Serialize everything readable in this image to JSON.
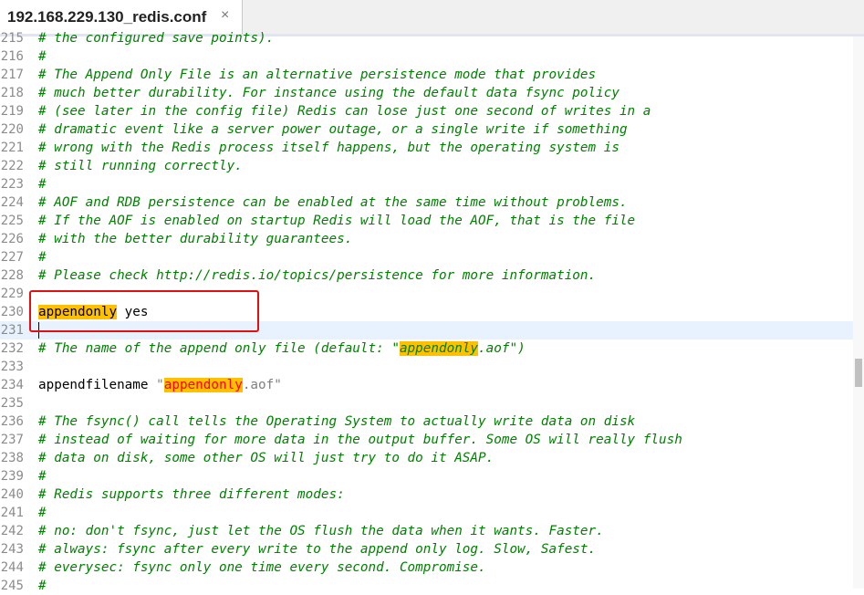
{
  "tab": {
    "title": "192.168.229.130_redis.conf",
    "close_icon": "×"
  },
  "lines": [
    {
      "n": "215",
      "segs": [
        {
          "t": "# the configured save points).",
          "c": "comment"
        }
      ]
    },
    {
      "n": "216",
      "segs": [
        {
          "t": "#",
          "c": "comment"
        }
      ]
    },
    {
      "n": "217",
      "segs": [
        {
          "t": "# The Append Only File is an alternative persistence mode that provides",
          "c": "comment"
        }
      ]
    },
    {
      "n": "218",
      "segs": [
        {
          "t": "# much better durability. For instance using the default data fsync policy",
          "c": "comment"
        }
      ]
    },
    {
      "n": "219",
      "segs": [
        {
          "t": "# (see later in the config file) Redis can lose just one second of writes in a",
          "c": "comment"
        }
      ]
    },
    {
      "n": "220",
      "segs": [
        {
          "t": "# dramatic event like a server power outage, or a single write if something",
          "c": "comment"
        }
      ]
    },
    {
      "n": "221",
      "segs": [
        {
          "t": "# wrong with the Redis process itself happens, but the operating system is",
          "c": "comment"
        }
      ]
    },
    {
      "n": "222",
      "segs": [
        {
          "t": "# still running correctly.",
          "c": "comment"
        }
      ]
    },
    {
      "n": "223",
      "segs": [
        {
          "t": "#",
          "c": "comment"
        }
      ]
    },
    {
      "n": "224",
      "segs": [
        {
          "t": "# AOF and RDB persistence can be enabled at the same time without problems.",
          "c": "comment"
        }
      ]
    },
    {
      "n": "225",
      "segs": [
        {
          "t": "# If the AOF is enabled on startup Redis will load the AOF, that is the file",
          "c": "comment"
        }
      ]
    },
    {
      "n": "226",
      "segs": [
        {
          "t": "# with the better durability guarantees.",
          "c": "comment"
        }
      ]
    },
    {
      "n": "227",
      "segs": [
        {
          "t": "#",
          "c": "comment"
        }
      ]
    },
    {
      "n": "228",
      "segs": [
        {
          "t": "# Please check http://redis.io/topics/persistence for more information.",
          "c": "comment"
        }
      ]
    },
    {
      "n": "229",
      "segs": []
    },
    {
      "n": "230",
      "segs": [
        {
          "t": "appendonly",
          "c": "hl-key"
        },
        {
          "t": " yes",
          "c": "plain"
        }
      ]
    },
    {
      "n": "231",
      "segs": [],
      "current": true
    },
    {
      "n": "232",
      "segs": [
        {
          "t": "# The name of the append only file (default: \"",
          "c": "comment"
        },
        {
          "t": "appendonly",
          "c": "hl-com"
        },
        {
          "t": ".aof\")",
          "c": "comment"
        }
      ]
    },
    {
      "n": "233",
      "segs": []
    },
    {
      "n": "234",
      "segs": [
        {
          "t": "appendfilename ",
          "c": "plain"
        },
        {
          "t": "\"",
          "c": "str"
        },
        {
          "t": "appendonly",
          "c": "hl-str"
        },
        {
          "t": ".aof\"",
          "c": "str"
        }
      ]
    },
    {
      "n": "235",
      "segs": []
    },
    {
      "n": "236",
      "segs": [
        {
          "t": "# The fsync() call tells the Operating System to actually write data on disk",
          "c": "comment"
        }
      ]
    },
    {
      "n": "237",
      "segs": [
        {
          "t": "# instead of waiting for more data in the output buffer. Some OS will really flush",
          "c": "comment"
        }
      ]
    },
    {
      "n": "238",
      "segs": [
        {
          "t": "# data on disk, some other OS will just try to do it ASAP.",
          "c": "comment"
        }
      ]
    },
    {
      "n": "239",
      "segs": [
        {
          "t": "#",
          "c": "comment"
        }
      ]
    },
    {
      "n": "240",
      "segs": [
        {
          "t": "# Redis supports three different modes:",
          "c": "comment"
        }
      ]
    },
    {
      "n": "241",
      "segs": [
        {
          "t": "#",
          "c": "comment"
        }
      ]
    },
    {
      "n": "242",
      "segs": [
        {
          "t": "# no: don't fsync, just let the OS flush the data when it wants. Faster.",
          "c": "comment"
        }
      ]
    },
    {
      "n": "243",
      "segs": [
        {
          "t": "# always: fsync after every write to the append only log. Slow, Safest.",
          "c": "comment"
        }
      ]
    },
    {
      "n": "244",
      "segs": [
        {
          "t": "# everysec: fsync only one time every second. Compromise.",
          "c": "comment"
        }
      ]
    },
    {
      "n": "245",
      "segs": [
        {
          "t": "#",
          "c": "comment"
        }
      ]
    }
  ]
}
